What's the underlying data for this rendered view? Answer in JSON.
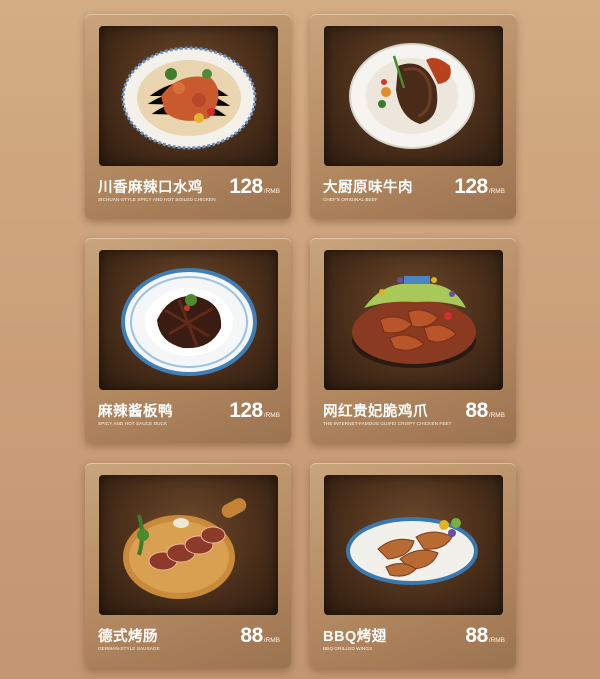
{
  "currency_unit": "/RMB",
  "dishes": [
    {
      "name": "川香麻辣口水鸡",
      "subtitle": "SICHUAN-STYLE SPICY AND HOT BOILED CHICKEN",
      "price": "128",
      "image": "spicy-chicken-dish-photo"
    },
    {
      "name": "大厨原味牛肉",
      "subtitle": "CHEF'S ORIGINAL BEEF",
      "price": "128",
      "image": "original-beef-dish-photo"
    },
    {
      "name": "麻辣酱板鸭",
      "subtitle": "SPICY AND HOT SAUCE DUCK",
      "price": "128",
      "image": "sauce-duck-dish-photo"
    },
    {
      "name": "网红贵妃脆鸡爪",
      "subtitle": "THE INTERNET-FAMOUS GUIFEI CRISPY CHICKEN FEET",
      "price": "88",
      "image": "crispy-chicken-feet-dish-photo"
    },
    {
      "name": "德式烤肠",
      "subtitle": "GERMAN-STYLE SAUSAGE",
      "price": "88",
      "image": "german-sausage-dish-photo"
    },
    {
      "name": "BBQ烤翅",
      "subtitle": "BBQ GRILLED WINGS",
      "price": "88",
      "image": "bbq-wings-dish-photo"
    }
  ]
}
